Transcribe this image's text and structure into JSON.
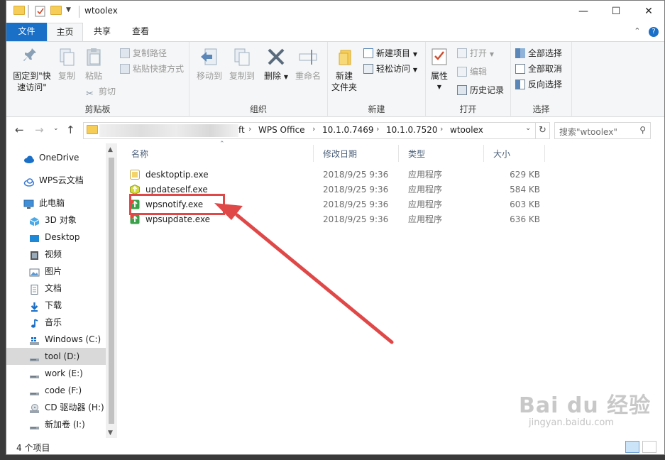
{
  "window": {
    "title": "wtoolex",
    "controls": {
      "minimize": "—",
      "maximize": "☐",
      "close": "✕"
    }
  },
  "ribbon_tabs": {
    "file": "文件",
    "home": "主页",
    "share": "共享",
    "view": "查看"
  },
  "ribbon": {
    "clipboard": {
      "label": "剪贴板",
      "pin": "固定到\"快\n速访问\"",
      "copy": "复制",
      "paste": "粘贴",
      "copy_path": "复制路径",
      "paste_shortcut": "粘贴快捷方式",
      "cut": "剪切"
    },
    "organize": {
      "label": "组织",
      "move_to": "移动到",
      "copy_to": "复制到",
      "delete": "删除",
      "rename": "重命名"
    },
    "new": {
      "label": "新建",
      "new_folder": "新建\n文件夹",
      "new_item": "新建项目",
      "easy_access": "轻松访问"
    },
    "open": {
      "label": "打开",
      "properties": "属性",
      "open": "打开",
      "edit": "编辑",
      "history": "历史记录"
    },
    "select": {
      "label": "选择",
      "select_all": "全部选择",
      "select_none": "全部取消",
      "invert": "反向选择"
    }
  },
  "address": {
    "crumbs": [
      "ft",
      "WPS Office",
      "10.1.0.7469",
      "10.1.0.7520",
      "wtoolex"
    ],
    "search_placeholder": "搜索\"wtoolex\""
  },
  "nav": [
    {
      "label": "OneDrive",
      "icon": "cloud-icon"
    },
    {
      "label": "WPS云文档",
      "icon": "wps-cloud-icon"
    },
    {
      "label": "此电脑",
      "icon": "computer-icon"
    },
    {
      "label": "3D 对象",
      "icon": "3d-objects-icon"
    },
    {
      "label": "Desktop",
      "icon": "desktop-icon"
    },
    {
      "label": "视频",
      "icon": "video-icon"
    },
    {
      "label": "图片",
      "icon": "pictures-icon"
    },
    {
      "label": "文档",
      "icon": "documents-icon"
    },
    {
      "label": "下载",
      "icon": "download-icon"
    },
    {
      "label": "音乐",
      "icon": "music-icon"
    },
    {
      "label": "Windows (C:)",
      "icon": "windows-drive-icon"
    },
    {
      "label": "tool (D:)",
      "icon": "drive-icon"
    },
    {
      "label": "work (E:)",
      "icon": "drive-icon"
    },
    {
      "label": "code (F:)",
      "icon": "drive-icon"
    },
    {
      "label": "CD 驱动器 (H:)",
      "icon": "cd-drive-icon"
    },
    {
      "label": "新加卷 (I:)",
      "icon": "drive-icon"
    }
  ],
  "columns": {
    "name": "名称",
    "modified": "修改日期",
    "type": "类型",
    "size": "大小"
  },
  "files": [
    {
      "name": "desktoptip.exe",
      "modified": "2018/9/25 9:36",
      "type": "应用程序",
      "size": "629 KB",
      "icon": "desktoptip-icon"
    },
    {
      "name": "updateself.exe",
      "modified": "2018/9/25 9:36",
      "type": "应用程序",
      "size": "584 KB",
      "icon": "updateself-icon"
    },
    {
      "name": "wpsnotify.exe",
      "modified": "2018/9/25 9:36",
      "type": "应用程序",
      "size": "603 KB",
      "icon": "wps-update-icon"
    },
    {
      "name": "wpsupdate.exe",
      "modified": "2018/9/25 9:36",
      "type": "应用程序",
      "size": "636 KB",
      "icon": "wps-update-icon"
    }
  ],
  "status": {
    "item_count": "4 个项目"
  },
  "watermark": {
    "logo": "Bai du 经验",
    "url": "jingyan.baidu.com"
  },
  "colors": {
    "accent": "#1a6fc7",
    "annotation_red": "#e04848",
    "selected_nav": "#d9d9d9"
  }
}
